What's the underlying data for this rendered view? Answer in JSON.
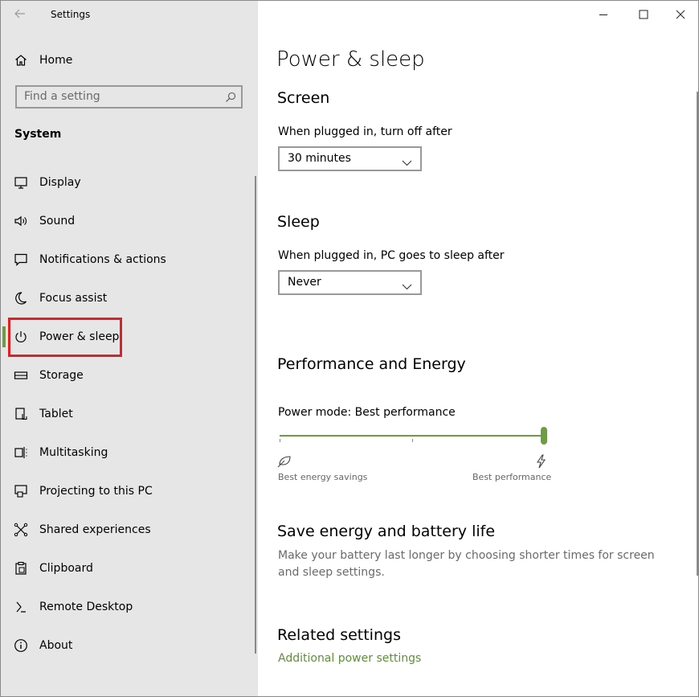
{
  "window": {
    "title": "Settings",
    "accent_color": "#6e9c45",
    "highlight_color": "#e11f26"
  },
  "sidebar": {
    "home_label": "Home",
    "search_placeholder": "Find a setting",
    "section_heading": "System",
    "selected_item": "Power & sleep",
    "items": [
      {
        "label": "Display",
        "icon": "monitor-icon"
      },
      {
        "label": "Sound",
        "icon": "speaker-icon"
      },
      {
        "label": "Notifications & actions",
        "icon": "notification-icon"
      },
      {
        "label": "Focus assist",
        "icon": "moon-icon"
      },
      {
        "label": "Power & sleep",
        "icon": "power-icon"
      },
      {
        "label": "Storage",
        "icon": "storage-icon"
      },
      {
        "label": "Tablet",
        "icon": "tablet-icon"
      },
      {
        "label": "Multitasking",
        "icon": "multitasking-icon"
      },
      {
        "label": "Projecting to this PC",
        "icon": "projector-icon"
      },
      {
        "label": "Shared experiences",
        "icon": "shared-icon"
      },
      {
        "label": "Clipboard",
        "icon": "clipboard-icon"
      },
      {
        "label": "Remote Desktop",
        "icon": "remote-desktop-icon"
      },
      {
        "label": "About",
        "icon": "info-icon"
      }
    ]
  },
  "main": {
    "page_title": "Power & sleep",
    "screen": {
      "heading": "Screen",
      "label": "When plugged in, turn off after",
      "value": "30 minutes"
    },
    "sleep": {
      "heading": "Sleep",
      "label": "When plugged in, PC goes to sleep after",
      "value": "Never"
    },
    "performance": {
      "heading": "Performance and Energy",
      "mode_label": "Power mode: Best performance",
      "slider_value": 1.0,
      "left_label": "Best energy savings",
      "right_label": "Best performance"
    },
    "save_energy": {
      "heading": "Save energy and battery life",
      "description": "Make your battery last longer by choosing shorter times for screen and sleep settings."
    },
    "related": {
      "heading": "Related settings",
      "link": "Additional power settings"
    }
  }
}
